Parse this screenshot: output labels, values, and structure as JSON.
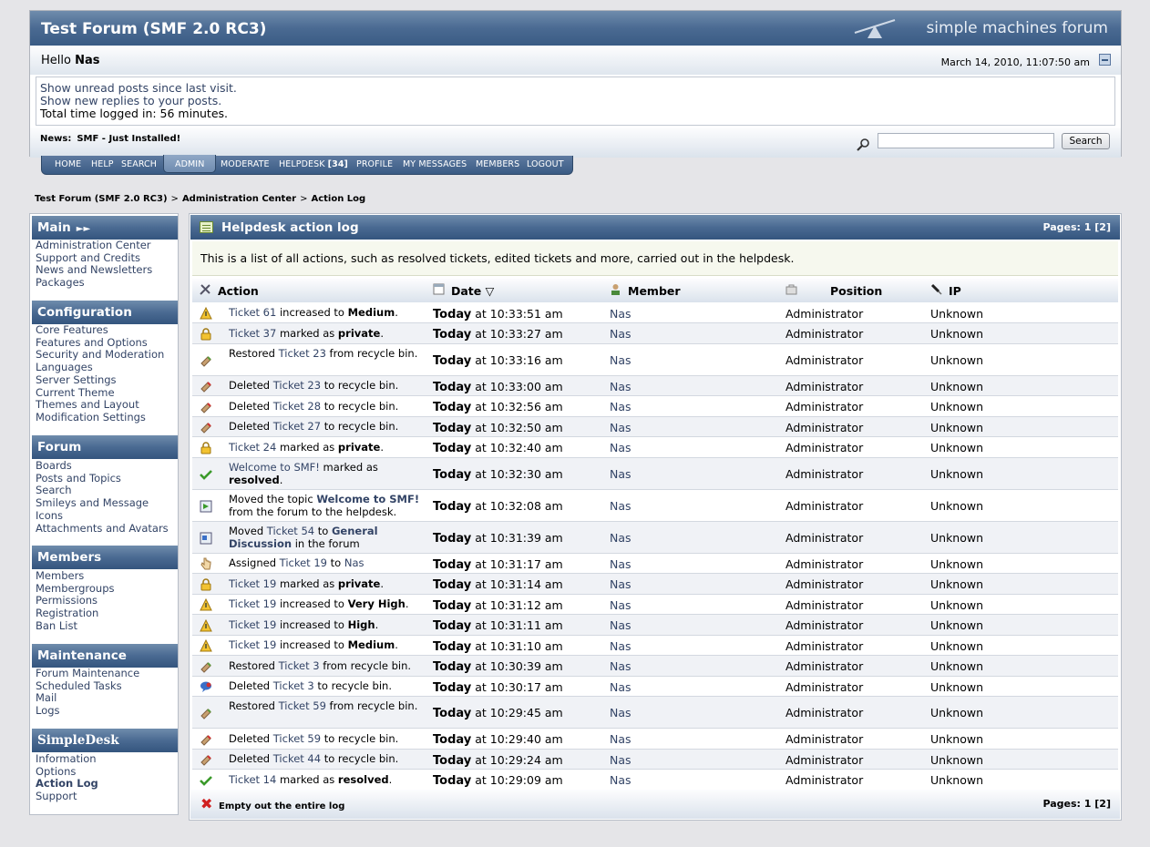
{
  "header": {
    "forum_title": "Test Forum (SMF 2.0 RC3)",
    "logo_text": "simple machines forum",
    "hello_prefix": "Hello",
    "username": "Nas",
    "datetime": "March 14, 2010, 11:07:50 am",
    "show_unread": "Show unread posts since last visit.",
    "show_replies": "Show new replies to your posts.",
    "time_logged": "Total time logged in: 56 minutes.",
    "news_label": "News:",
    "news_text": "SMF - Just Installed!",
    "search_value": "",
    "search_button": "Search"
  },
  "menu": {
    "home": "HOME",
    "help": "HELP",
    "search": "SEARCH",
    "admin": "ADMIN",
    "moderate": "MODERATE",
    "helpdesk": "HELPDESK",
    "helpdesk_count": "[34]",
    "profile": "PROFILE",
    "my_messages": "MY MESSAGES",
    "members": "MEMBERS",
    "logout": "LOGOUT"
  },
  "breadcrumb": [
    "Test Forum (SMF 2.0 RC3)",
    "Administration Center",
    "Action Log"
  ],
  "breadcrumb_sep": ">",
  "sidebar": {
    "main": {
      "title": "Main",
      "items": [
        "Administration Center",
        "Support and Credits",
        "News and Newsletters",
        "Packages"
      ]
    },
    "configuration": {
      "title": "Configuration",
      "items": [
        "Core Features",
        "Features and Options",
        "Security and Moderation",
        "Languages",
        "Server Settings",
        "Current Theme",
        "Themes and Layout",
        "Modification Settings"
      ]
    },
    "forum": {
      "title": "Forum",
      "items": [
        "Boards",
        "Posts and Topics",
        "Search",
        "Smileys and Message",
        "Icons",
        "Attachments and Avatars"
      ]
    },
    "members": {
      "title": "Members",
      "items": [
        "Members",
        "Membergroups",
        "Permissions",
        "Registration",
        "Ban List"
      ]
    },
    "maintenance": {
      "title": "Maintenance",
      "items": [
        "Forum Maintenance",
        "Scheduled Tasks",
        "Mail",
        "Logs"
      ]
    },
    "simpledesk": {
      "title": "SimpleDesk",
      "items": [
        "Information",
        "Options",
        "Action Log",
        "Support"
      ]
    }
  },
  "panel": {
    "title": "Helpdesk action log",
    "pages_label": "Pages:",
    "page_current": "1",
    "page_next": "[2]",
    "description": "This is a list of all actions, such as resolved tickets, edited tickets and more, carried out in the helpdesk.",
    "columns": {
      "action": "Action",
      "date": "Date",
      "member": "Member",
      "position": "Position",
      "ip": "IP"
    },
    "empty_log": "Empty out the entire log"
  },
  "log_rows": [
    {
      "icon": "priority-up-icon",
      "parts": [
        [
          "l",
          "Ticket 61"
        ],
        [
          "t",
          " increased to "
        ],
        [
          "b",
          "Medium"
        ],
        [
          "t",
          "."
        ]
      ],
      "day": "Today",
      "time": "at 10:33:51 am",
      "member": "Nas",
      "position": "Administrator",
      "ip": "Unknown"
    },
    {
      "icon": "private-lock-icon",
      "parts": [
        [
          "l",
          "Ticket 37"
        ],
        [
          "t",
          " marked as "
        ],
        [
          "b",
          "private"
        ],
        [
          "t",
          "."
        ]
      ],
      "day": "Today",
      "time": "at 10:33:27 am",
      "member": "Nas",
      "position": "Administrator",
      "ip": "Unknown"
    },
    {
      "icon": "restore-icon",
      "parts": [
        [
          "t",
          "Restored "
        ],
        [
          "l",
          "Ticket 23"
        ],
        [
          "t",
          " from recycle bin."
        ]
      ],
      "day": "Today",
      "time": "at 10:33:16 am",
      "member": "Nas",
      "position": "Administrator",
      "ip": "Unknown"
    },
    {
      "icon": "delete-icon",
      "parts": [
        [
          "t",
          "Deleted "
        ],
        [
          "l",
          "Ticket 23"
        ],
        [
          "t",
          " to recycle bin."
        ]
      ],
      "day": "Today",
      "time": "at 10:33:00 am",
      "member": "Nas",
      "position": "Administrator",
      "ip": "Unknown"
    },
    {
      "icon": "delete-icon",
      "parts": [
        [
          "t",
          "Deleted "
        ],
        [
          "l",
          "Ticket 28"
        ],
        [
          "t",
          " to recycle bin."
        ]
      ],
      "day": "Today",
      "time": "at 10:32:56 am",
      "member": "Nas",
      "position": "Administrator",
      "ip": "Unknown"
    },
    {
      "icon": "delete-icon",
      "parts": [
        [
          "t",
          "Deleted "
        ],
        [
          "l",
          "Ticket 27"
        ],
        [
          "t",
          " to recycle bin."
        ]
      ],
      "day": "Today",
      "time": "at 10:32:50 am",
      "member": "Nas",
      "position": "Administrator",
      "ip": "Unknown"
    },
    {
      "icon": "private-lock-icon",
      "parts": [
        [
          "l",
          "Ticket 24"
        ],
        [
          "t",
          " marked as "
        ],
        [
          "b",
          "private"
        ],
        [
          "t",
          "."
        ]
      ],
      "day": "Today",
      "time": "at 10:32:40 am",
      "member": "Nas",
      "position": "Administrator",
      "ip": "Unknown"
    },
    {
      "icon": "resolved-check-icon",
      "parts": [
        [
          "l",
          "Welcome to SMF!"
        ],
        [
          "t",
          " marked as "
        ],
        [
          "b",
          "resolved"
        ],
        [
          "t",
          "."
        ]
      ],
      "day": "Today",
      "time": "at 10:32:30 am",
      "member": "Nas",
      "position": "Administrator",
      "ip": "Unknown"
    },
    {
      "icon": "move-to-helpdesk-icon",
      "parts": [
        [
          "t",
          "Moved the topic "
        ],
        [
          "lb",
          "Welcome to SMF!"
        ],
        [
          "t",
          " from the forum to the helpdesk."
        ]
      ],
      "day": "Today",
      "time": "at 10:32:08 am",
      "member": "Nas",
      "position": "Administrator",
      "ip": "Unknown"
    },
    {
      "icon": "move-to-forum-icon",
      "parts": [
        [
          "t",
          "Moved "
        ],
        [
          "l",
          "Ticket 54"
        ],
        [
          "t",
          " to "
        ],
        [
          "lb",
          "General Discussion"
        ],
        [
          "t",
          " in the forum"
        ]
      ],
      "day": "Today",
      "time": "at 10:31:39 am",
      "member": "Nas",
      "position": "Administrator",
      "ip": "Unknown"
    },
    {
      "icon": "assign-hand-icon",
      "parts": [
        [
          "t",
          "Assigned "
        ],
        [
          "l",
          "Ticket 19"
        ],
        [
          "t",
          " to "
        ],
        [
          "l",
          "Nas"
        ]
      ],
      "day": "Today",
      "time": "at 10:31:17 am",
      "member": "Nas",
      "position": "Administrator",
      "ip": "Unknown"
    },
    {
      "icon": "private-lock-icon",
      "parts": [
        [
          "l",
          "Ticket 19"
        ],
        [
          "t",
          " marked as "
        ],
        [
          "b",
          "private"
        ],
        [
          "t",
          "."
        ]
      ],
      "day": "Today",
      "time": "at 10:31:14 am",
      "member": "Nas",
      "position": "Administrator",
      "ip": "Unknown"
    },
    {
      "icon": "priority-up-icon",
      "parts": [
        [
          "l",
          "Ticket 19"
        ],
        [
          "t",
          " increased to "
        ],
        [
          "b",
          "Very High"
        ],
        [
          "t",
          "."
        ]
      ],
      "day": "Today",
      "time": "at 10:31:12 am",
      "member": "Nas",
      "position": "Administrator",
      "ip": "Unknown"
    },
    {
      "icon": "priority-up-icon",
      "parts": [
        [
          "l",
          "Ticket 19"
        ],
        [
          "t",
          " increased to "
        ],
        [
          "b",
          "High"
        ],
        [
          "t",
          "."
        ]
      ],
      "day": "Today",
      "time": "at 10:31:11 am",
      "member": "Nas",
      "position": "Administrator",
      "ip": "Unknown"
    },
    {
      "icon": "priority-up-icon",
      "parts": [
        [
          "l",
          "Ticket 19"
        ],
        [
          "t",
          " increased to "
        ],
        [
          "b",
          "Medium"
        ],
        [
          "t",
          "."
        ]
      ],
      "day": "Today",
      "time": "at 10:31:10 am",
      "member": "Nas",
      "position": "Administrator",
      "ip": "Unknown"
    },
    {
      "icon": "restore-icon",
      "parts": [
        [
          "t",
          "Restored "
        ],
        [
          "l",
          "Ticket 3"
        ],
        [
          "t",
          " from recycle bin."
        ]
      ],
      "day": "Today",
      "time": "at 10:30:39 am",
      "member": "Nas",
      "position": "Administrator",
      "ip": "Unknown"
    },
    {
      "icon": "delete-reply-icon",
      "parts": [
        [
          "t",
          "Deleted "
        ],
        [
          "l",
          "Ticket 3"
        ],
        [
          "t",
          " to recycle bin."
        ]
      ],
      "day": "Today",
      "time": "at 10:30:17 am",
      "member": "Nas",
      "position": "Administrator",
      "ip": "Unknown"
    },
    {
      "icon": "restore-icon",
      "parts": [
        [
          "t",
          "Restored "
        ],
        [
          "l",
          "Ticket 59"
        ],
        [
          "t",
          " from recycle bin."
        ]
      ],
      "day": "Today",
      "time": "at 10:29:45 am",
      "member": "Nas",
      "position": "Administrator",
      "ip": "Unknown"
    },
    {
      "icon": "delete-icon",
      "parts": [
        [
          "t",
          "Deleted "
        ],
        [
          "l",
          "Ticket 59"
        ],
        [
          "t",
          " to recycle bin."
        ]
      ],
      "day": "Today",
      "time": "at 10:29:40 am",
      "member": "Nas",
      "position": "Administrator",
      "ip": "Unknown"
    },
    {
      "icon": "delete-icon",
      "parts": [
        [
          "t",
          "Deleted "
        ],
        [
          "l",
          "Ticket 44"
        ],
        [
          "t",
          " to recycle bin."
        ]
      ],
      "day": "Today",
      "time": "at 10:29:24 am",
      "member": "Nas",
      "position": "Administrator",
      "ip": "Unknown"
    },
    {
      "icon": "resolved-check-icon",
      "parts": [
        [
          "l",
          "Ticket 14"
        ],
        [
          "t",
          " marked as "
        ],
        [
          "b",
          "resolved"
        ],
        [
          "t",
          "."
        ]
      ],
      "day": "Today",
      "time": "at 10:29:09 am",
      "member": "Nas",
      "position": "Administrator",
      "ip": "Unknown"
    }
  ],
  "colors": {
    "header_blue": "#4a6a92",
    "link": "#334466",
    "delete_red": "#d02020",
    "check_green": "#3a9a2a"
  }
}
